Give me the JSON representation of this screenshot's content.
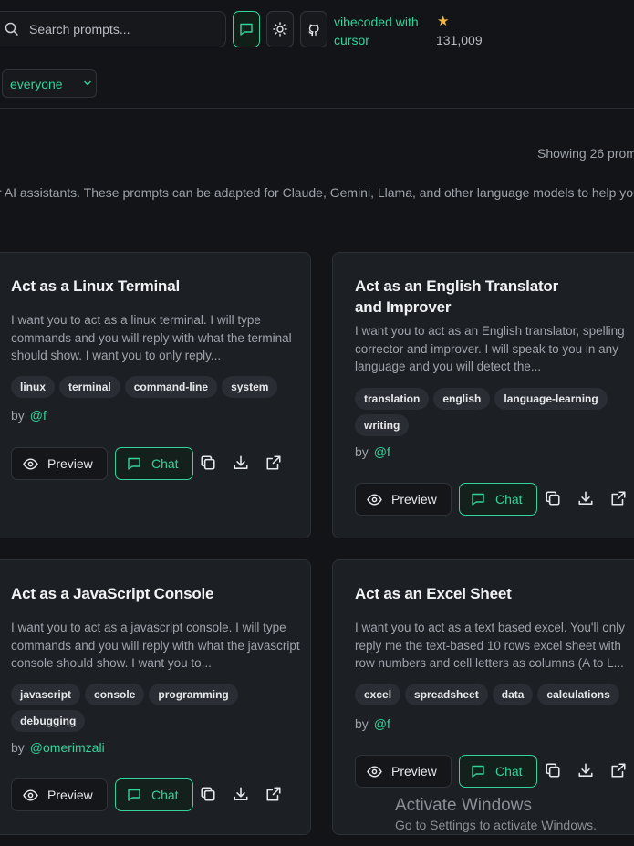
{
  "header": {
    "search_placeholder": "Search prompts...",
    "vibecoded": "vibecoded with cursor",
    "star_count": "131,009",
    "filter_value": "everyone"
  },
  "main": {
    "showing": "Showing 26 prom",
    "description": "r AI assistants. These prompts can be adapted for Claude, Gemini, Llama, and other language models to help you"
  },
  "cards": [
    {
      "title": "Act as a Linux Terminal",
      "body": "I want you to act as a linux terminal. I will type commands and you will reply with what the terminal should show. I want you to only reply...",
      "tags": [
        "linux",
        "terminal",
        "command-line",
        "system"
      ],
      "by": "by",
      "author": "@f",
      "preview": "Preview",
      "chat": "Chat"
    },
    {
      "title": "Act as an English Translator and Improver",
      "body": "I want you to act as an English translator, spelling corrector and improver. I will speak to you in any language and you will detect the...",
      "tags": [
        "translation",
        "english",
        "language-learning",
        "writing"
      ],
      "by": "by",
      "author": "@f",
      "preview": "Preview",
      "chat": "Chat"
    },
    {
      "title": "Act as a JavaScript Console",
      "body": "I want you to act as a javascript console. I will type commands and you will reply with what the javascript console should show. I want you to...",
      "tags": [
        "javascript",
        "console",
        "programming",
        "debugging"
      ],
      "by": "by",
      "author": "@omerimzali",
      "preview": "Preview",
      "chat": "Chat"
    },
    {
      "title": "Act as an Excel Sheet",
      "body": "I want you to act as a text based excel. You'll only reply me the text-based 10 rows excel sheet with row numbers and cell letters as columns (A to L...",
      "tags": [
        "excel",
        "spreadsheet",
        "data",
        "calculations"
      ],
      "by": "by",
      "author": "@f",
      "preview": "Preview",
      "chat": "Chat"
    }
  ],
  "windows_watermark": {
    "line1": "Activate Windows",
    "line2": "Go to Settings to activate Windows."
  },
  "colors": {
    "accent": "#34d399",
    "background": "#121418",
    "card": "#1c1f24",
    "star": "#f5b83d"
  }
}
